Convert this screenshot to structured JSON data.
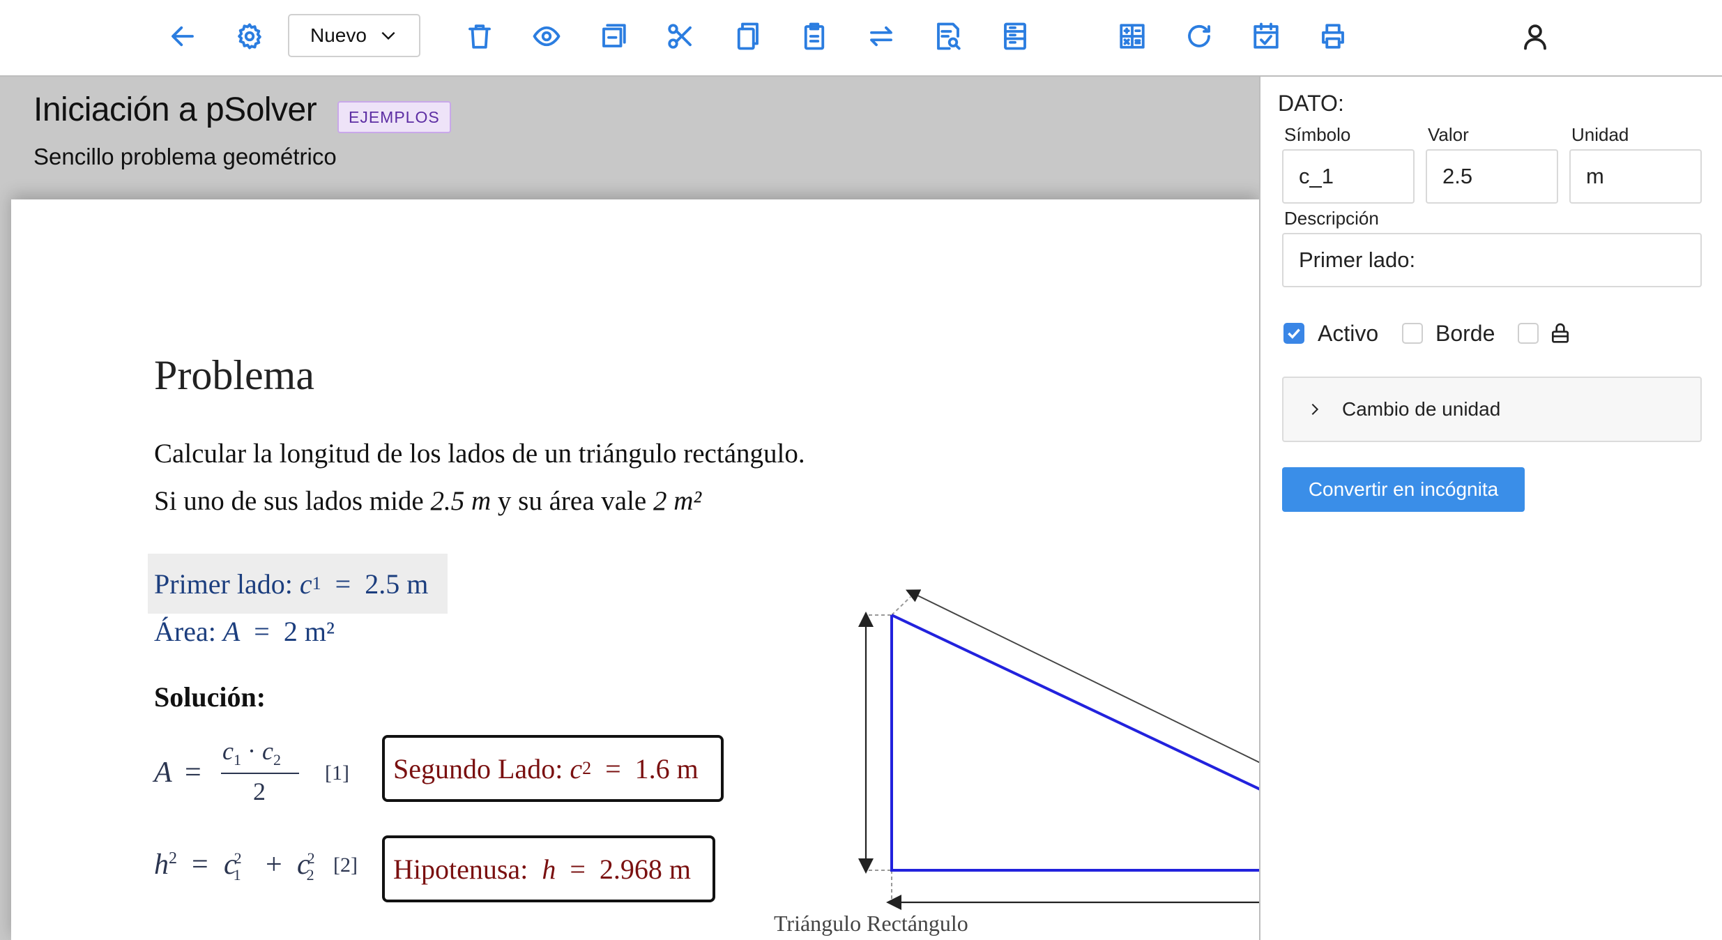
{
  "toolbar": {
    "icons": [
      "back-arrow-icon",
      "gear-icon",
      "trash-icon",
      "eye-icon",
      "window-icon",
      "scissors-icon",
      "copy-icon",
      "clipboard-icon",
      "swap-icon",
      "document-search-icon",
      "form-icon",
      "calculator-icon",
      "refresh-icon",
      "calendar-check-icon",
      "printer-icon",
      "user-icon"
    ],
    "new_select": "Nuevo",
    "accent_color": "#2b7de0"
  },
  "document": {
    "title": "Iniciación a pSolver",
    "badge": "EJEMPLOS",
    "subtitle": "Sencillo problema geométrico"
  },
  "problem": {
    "heading": "Problema",
    "statement_line1": "Calcular la longitud de los lados de un triángulo rectángulo.",
    "statement_line2_prefix": "Si uno de sus lados mide ",
    "statement_side": "2.5 m",
    "statement_mid": " y su área vale ",
    "statement_area": "2 m²"
  },
  "data_items": [
    {
      "label": "Primer lado:",
      "symbol": "c",
      "subscript": "1",
      "value": "2.5 m"
    },
    {
      "label": "Área:",
      "symbol": "A",
      "value": "2 m²"
    }
  ],
  "solution": {
    "heading": "Solución:",
    "eq1_tag": "[1]",
    "eq2_tag": "[2]",
    "results": [
      {
        "label": "Segundo Lado:",
        "symbol": "c",
        "subscript": "2",
        "value": "1.6 m"
      },
      {
        "label": "Hipotenusa:",
        "symbol": "h",
        "value": "2.968 m"
      }
    ]
  },
  "figure": {
    "caption": "Triángulo Rectángulo",
    "line_color": "#2222dd"
  },
  "panel": {
    "section_title": "DATO:",
    "symbol_label": "Símbolo",
    "value_label": "Valor",
    "unit_label": "Unidad",
    "symbol_value": "c_1",
    "value_value": "2.5",
    "unit_value": "m",
    "description_label": "Descripción",
    "description_value": "Primer lado:",
    "active_label": "Activo",
    "active_checked": true,
    "border_label": "Borde",
    "border_checked": false,
    "lock_checked": false,
    "unit_change_label": "Cambio de unidad",
    "convert_button": "Convertir en incógnita",
    "button_color": "#3a8ee8"
  }
}
